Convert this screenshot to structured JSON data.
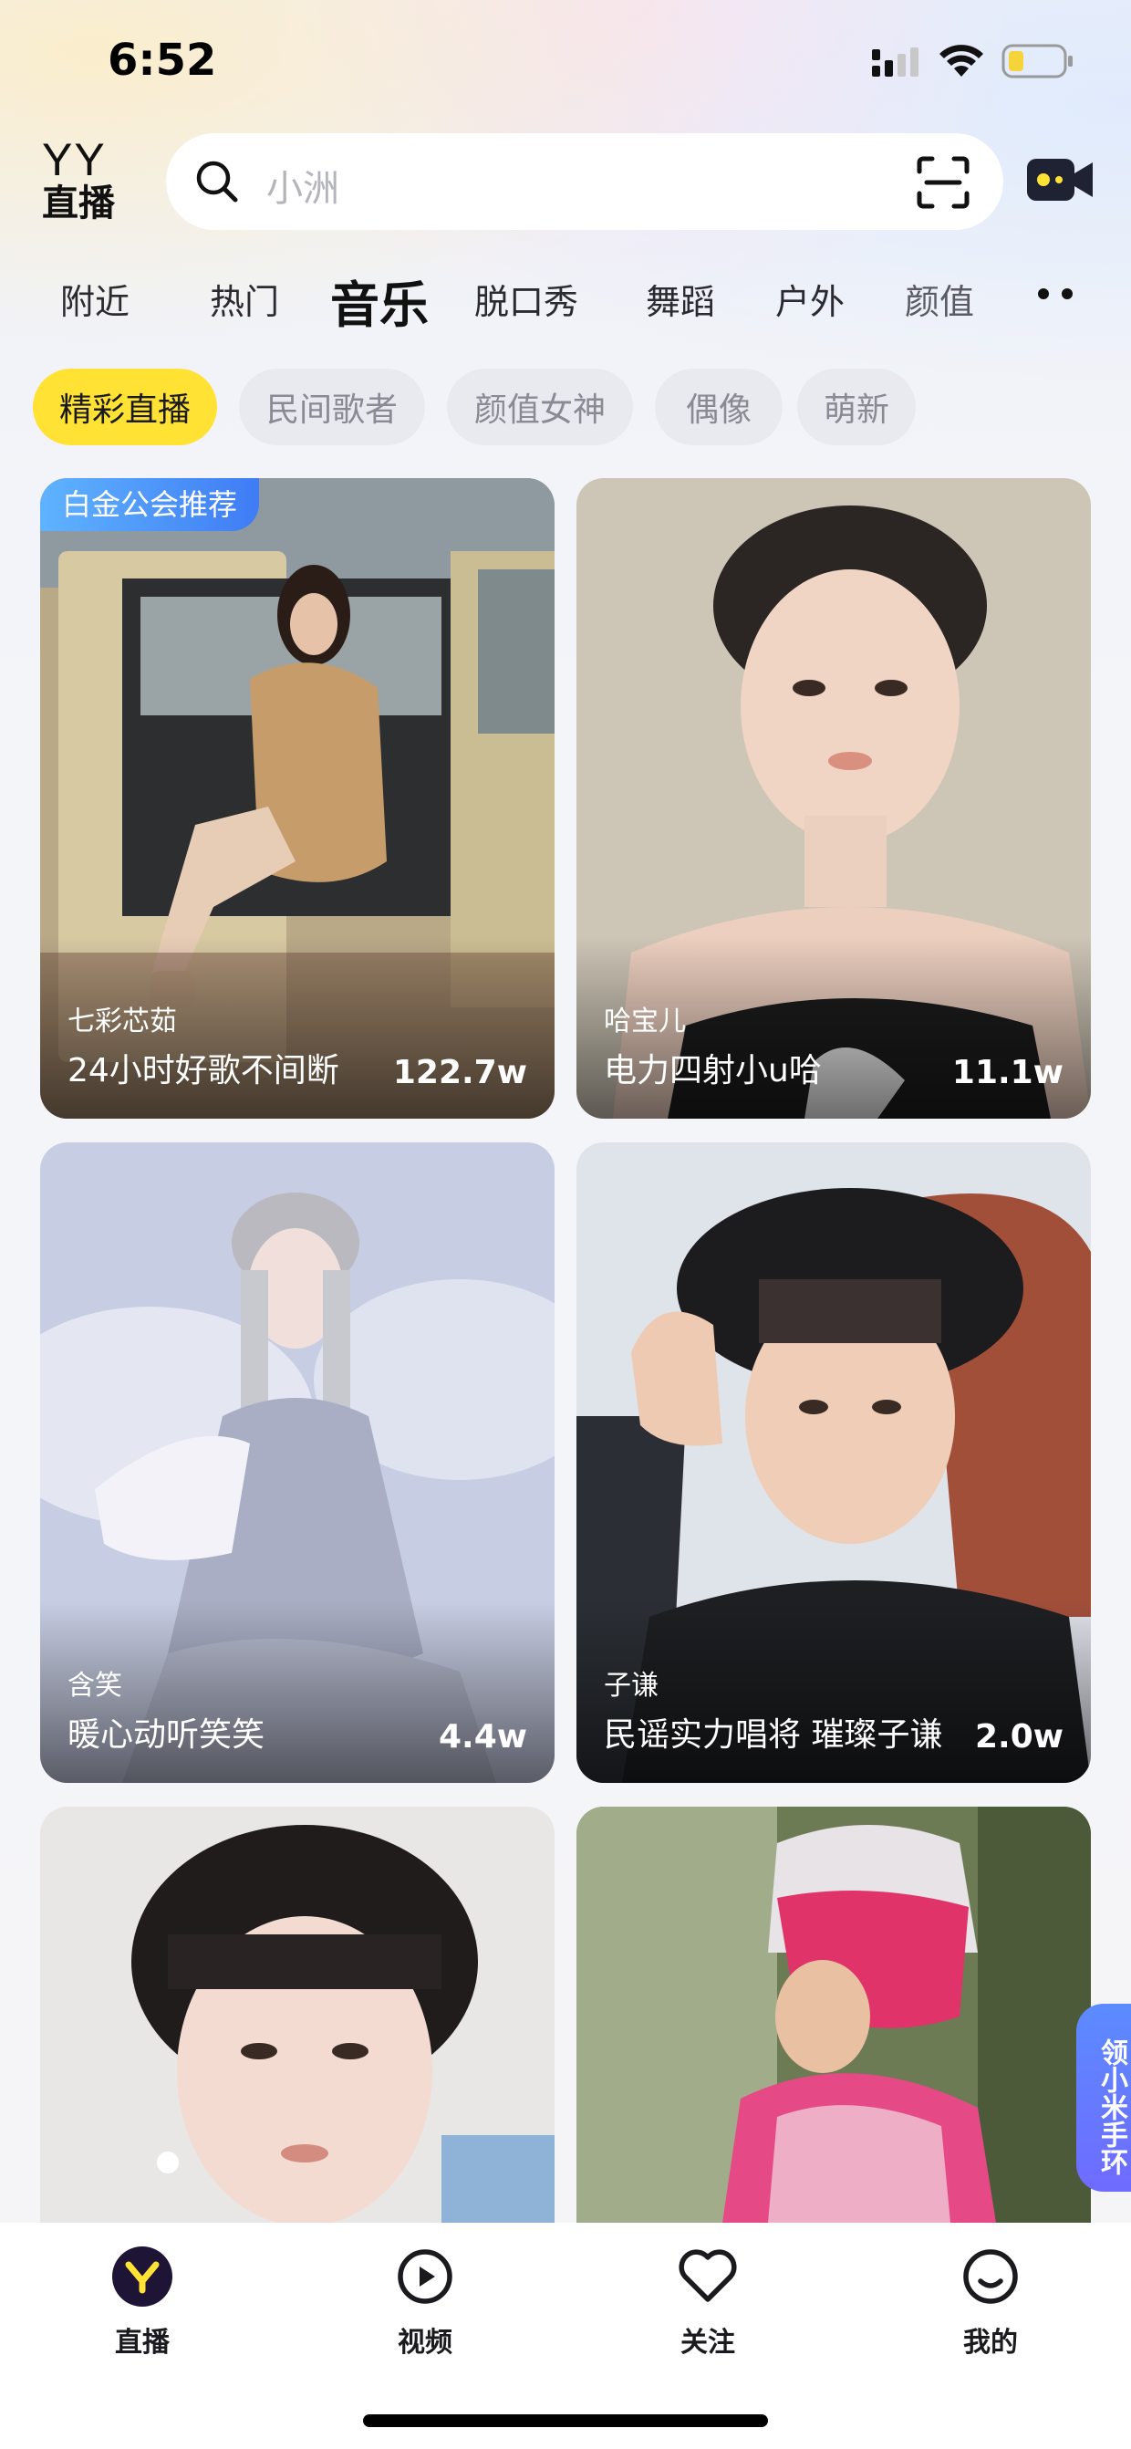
{
  "status_bar": {
    "time": "6:52"
  },
  "header": {
    "logo_top": "YY",
    "logo_bottom": "直播",
    "search_placeholder": "小洲"
  },
  "category_tabs": [
    {
      "label": "附近",
      "active": false
    },
    {
      "label": "热门",
      "active": false
    },
    {
      "label": "音乐",
      "active": true
    },
    {
      "label": "脱口秀",
      "active": false
    },
    {
      "label": "舞蹈",
      "active": false
    },
    {
      "label": "户外",
      "active": false
    },
    {
      "label": "颜值",
      "active": false
    }
  ],
  "chips": [
    {
      "label": "精彩直播",
      "active": true
    },
    {
      "label": "民间歌者",
      "active": false
    },
    {
      "label": "颜值女神",
      "active": false
    },
    {
      "label": "偶像",
      "active": false
    },
    {
      "label": "萌新",
      "active": false
    }
  ],
  "cards": [
    {
      "badge": "白金公会推荐",
      "badge_tag": "推荐",
      "anchor": "七彩芯茹",
      "title": "24小时好歌不间断",
      "viewers": "122.7w"
    },
    {
      "anchor": "哈宝儿",
      "title": "电力四射小u哈",
      "viewers": "11.1w"
    },
    {
      "anchor": "含笑",
      "title": "暖心动听笑笑",
      "viewers": "4.4w"
    },
    {
      "anchor": "子谦",
      "title": "民谣实力唱将 璀璨子谦",
      "viewers": "2.0w"
    },
    {
      "anchor": "",
      "title": "",
      "viewers": ""
    },
    {
      "anchor": "",
      "title": "",
      "viewers": ""
    }
  ],
  "side_float": {
    "label": "领小米手环"
  },
  "bottom_nav": [
    {
      "label": "直播",
      "icon": "yy-live-icon"
    },
    {
      "label": "视频",
      "icon": "video-icon"
    },
    {
      "label": "关注",
      "icon": "heart-icon"
    },
    {
      "label": "我的",
      "icon": "profile-icon"
    }
  ],
  "colors": {
    "accent_yellow": "#ffe234",
    "badge_blue": "#3f7cf5"
  }
}
